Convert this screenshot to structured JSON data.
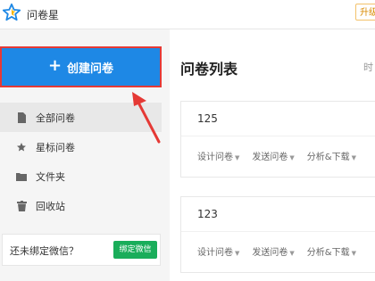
{
  "header": {
    "app_name": "问卷星",
    "upgrade_label": "升级"
  },
  "sidebar": {
    "create_label": "创建问卷",
    "items": [
      {
        "label": "全部问卷",
        "icon": "document-icon",
        "active": true
      },
      {
        "label": "星标问卷",
        "icon": "star-icon",
        "active": false
      },
      {
        "label": "文件夹",
        "icon": "folder-icon",
        "active": false
      },
      {
        "label": "回收站",
        "icon": "trash-icon",
        "active": false
      }
    ],
    "wechat_prompt": "还未绑定微信？",
    "wechat_button": "绑定微信"
  },
  "main": {
    "title": "问卷列表",
    "time_label": "时",
    "surveys": [
      {
        "name": "125",
        "actions": [
          "设计问卷",
          "发送问卷",
          "分析&下载"
        ]
      },
      {
        "name": "123",
        "actions": [
          "设计问卷",
          "发送问卷",
          "分析&下载"
        ]
      }
    ]
  },
  "colors": {
    "primary": "#1e88e5",
    "annotation": "#e53935",
    "wechat": "#1aad5a",
    "logo": "#1e88e5"
  }
}
